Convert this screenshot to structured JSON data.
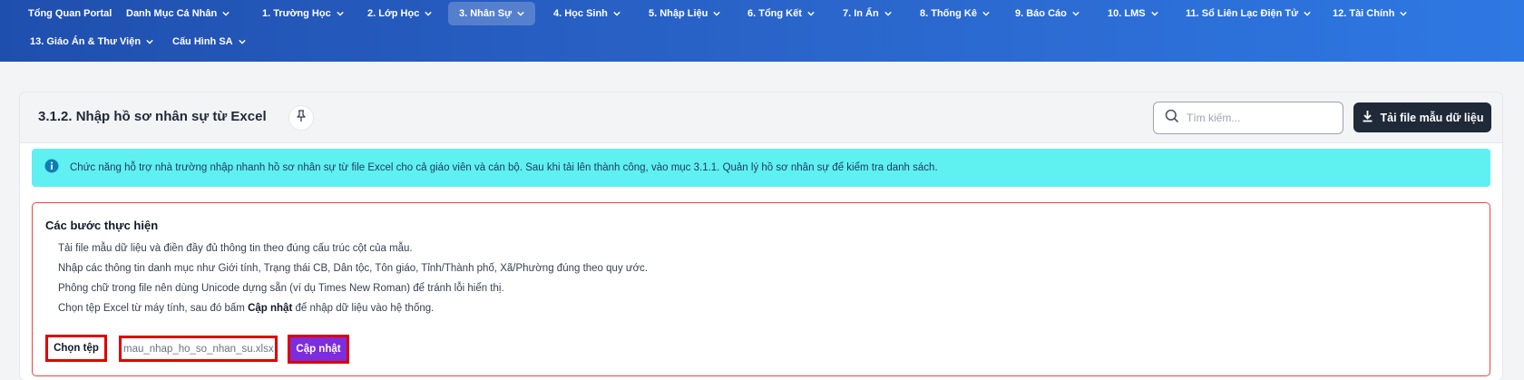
{
  "nav": {
    "items": [
      {
        "label": "Tổng Quan Portal",
        "has_menu": false,
        "active": false
      },
      {
        "label": "Danh Mục Cá Nhân",
        "has_menu": true,
        "active": false
      },
      {
        "label": "1. Trường Học",
        "has_menu": true,
        "active": false
      },
      {
        "label": "2. Lớp Học",
        "has_menu": true,
        "active": false
      },
      {
        "label": "3. Nhân Sự",
        "has_menu": true,
        "active": true
      },
      {
        "label": "4. Học Sinh",
        "has_menu": true,
        "active": false
      },
      {
        "label": "5. Nhập Liệu",
        "has_menu": true,
        "active": false
      },
      {
        "label": "6. Tổng Kết",
        "has_menu": true,
        "active": false
      },
      {
        "label": "7. In Ấn",
        "has_menu": true,
        "active": false
      },
      {
        "label": "8. Thống Kê",
        "has_menu": true,
        "active": false
      },
      {
        "label": "9. Báo Cáo",
        "has_menu": true,
        "active": false
      },
      {
        "label": "10. LMS",
        "has_menu": true,
        "active": false
      },
      {
        "label": "11. Sổ Liên Lạc Điện Tử",
        "has_menu": true,
        "active": false
      },
      {
        "label": "12. Tài Chính",
        "has_menu": true,
        "active": false
      },
      {
        "label": "13. Giáo Án & Thư Viện",
        "has_menu": true,
        "active": false
      },
      {
        "label": "Cấu Hình SA",
        "has_menu": true,
        "active": false
      }
    ]
  },
  "header": {
    "title": "3.1.2. Nhập hồ sơ nhân sự từ Excel",
    "search_placeholder": "Tìm kiếm...",
    "download_label": "Tải file mẫu dữ liệu"
  },
  "info": {
    "text": "Chức năng hỗ trợ nhà trường nhập nhanh hồ sơ nhân sự từ file Excel cho cả giáo viên và cán bộ. Sau khi tải lên thành công, vào mục 3.1.1. Quản lý hồ sơ nhân sự để kiểm tra danh sách."
  },
  "steps": {
    "title": "Các bước thực hiện",
    "line1": "Tải file mẫu dữ liệu và điền đầy đủ thông tin theo đúng cấu trúc cột của mẫu.",
    "line2": "Nhập các thông tin danh mục như Giới tính, Trạng thái CB, Dân tộc, Tôn giáo, Tỉnh/Thành phố, Xã/Phường đúng theo quy ước.",
    "line3": "Phông chữ trong file nên dùng Unicode dựng sẵn (ví dụ Times New Roman) để tránh lỗi hiển thị.",
    "line4_prefix": "Chọn tệp Excel từ máy tính, sau đó bấm",
    "line4_bold": "Cập nhật",
    "line4_suffix": "để nhập dữ liệu vào hệ thống."
  },
  "upload": {
    "choose_label": "Chọn tệp",
    "file_name": "mau_nhap_ho_so_nhan_su.xlsx",
    "update_label": "Cập nhật"
  },
  "colors": {
    "nav_gradient_start": "#1f4fae",
    "nav_gradient_end": "#2e78e3",
    "info_bg": "#5ff0f2",
    "update_button": "#7c2ddd",
    "highlight_border": "#e00000",
    "panel_border": "#ef4444"
  }
}
